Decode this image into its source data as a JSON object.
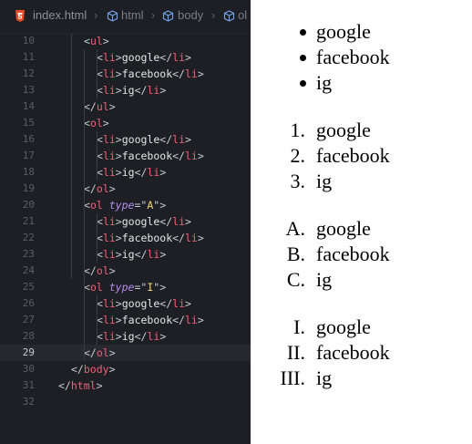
{
  "breadcrumb": {
    "file": "index.html",
    "items": [
      "html",
      "body",
      "ol"
    ]
  },
  "code_lines": [
    {
      "n": "10",
      "i": 2,
      "t": [
        [
          "t-br",
          "<"
        ],
        [
          "t-tag",
          "ul"
        ],
        [
          "t-br",
          ">"
        ]
      ]
    },
    {
      "n": "11",
      "i": 3,
      "t": [
        [
          "t-br",
          "<"
        ],
        [
          "t-tag",
          "li"
        ],
        [
          "t-br",
          ">"
        ],
        [
          "t-txt",
          "google"
        ],
        [
          "t-br",
          "</"
        ],
        [
          "t-tag",
          "li"
        ],
        [
          "t-br",
          ">"
        ]
      ]
    },
    {
      "n": "12",
      "i": 3,
      "t": [
        [
          "t-br",
          "<"
        ],
        [
          "t-tag",
          "li"
        ],
        [
          "t-br",
          ">"
        ],
        [
          "t-txt",
          "facebook"
        ],
        [
          "t-br",
          "</"
        ],
        [
          "t-tag",
          "li"
        ],
        [
          "t-br",
          ">"
        ]
      ]
    },
    {
      "n": "13",
      "i": 3,
      "t": [
        [
          "t-br",
          "<"
        ],
        [
          "t-tag",
          "li"
        ],
        [
          "t-br",
          ">"
        ],
        [
          "t-txt",
          "ig"
        ],
        [
          "t-br",
          "</"
        ],
        [
          "t-tag",
          "li"
        ],
        [
          "t-br",
          ">"
        ]
      ]
    },
    {
      "n": "14",
      "i": 2,
      "t": [
        [
          "t-br",
          "</"
        ],
        [
          "t-tag",
          "ul"
        ],
        [
          "t-br",
          ">"
        ]
      ]
    },
    {
      "n": "15",
      "i": 2,
      "t": [
        [
          "t-br",
          "<"
        ],
        [
          "t-tag",
          "ol"
        ],
        [
          "t-br",
          ">"
        ]
      ]
    },
    {
      "n": "16",
      "i": 3,
      "t": [
        [
          "t-br",
          "<"
        ],
        [
          "t-tag",
          "li"
        ],
        [
          "t-br",
          ">"
        ],
        [
          "t-txt",
          "google"
        ],
        [
          "t-br",
          "</"
        ],
        [
          "t-tag",
          "li"
        ],
        [
          "t-br",
          ">"
        ]
      ]
    },
    {
      "n": "17",
      "i": 3,
      "t": [
        [
          "t-br",
          "<"
        ],
        [
          "t-tag",
          "li"
        ],
        [
          "t-br",
          ">"
        ],
        [
          "t-txt",
          "facebook"
        ],
        [
          "t-br",
          "</"
        ],
        [
          "t-tag",
          "li"
        ],
        [
          "t-br",
          ">"
        ]
      ]
    },
    {
      "n": "18",
      "i": 3,
      "t": [
        [
          "t-br",
          "<"
        ],
        [
          "t-tag",
          "li"
        ],
        [
          "t-br",
          ">"
        ],
        [
          "t-txt",
          "ig"
        ],
        [
          "t-br",
          "</"
        ],
        [
          "t-tag",
          "li"
        ],
        [
          "t-br",
          ">"
        ]
      ]
    },
    {
      "n": "19",
      "i": 2,
      "t": [
        [
          "t-br",
          "</"
        ],
        [
          "t-tag",
          "ol"
        ],
        [
          "t-br",
          ">"
        ]
      ]
    },
    {
      "n": "20",
      "i": 2,
      "t": [
        [
          "t-br",
          "<"
        ],
        [
          "t-tag",
          "ol"
        ],
        [
          "t-txt",
          " "
        ],
        [
          "t-attr",
          "type"
        ],
        [
          "t-eq",
          "="
        ],
        [
          "t-q",
          "\""
        ],
        [
          "t-str",
          "A"
        ],
        [
          "t-q",
          "\""
        ],
        [
          "t-br",
          ">"
        ]
      ]
    },
    {
      "n": "21",
      "i": 3,
      "t": [
        [
          "t-br",
          "<"
        ],
        [
          "t-tag",
          "li"
        ],
        [
          "t-br",
          ">"
        ],
        [
          "t-txt",
          "google"
        ],
        [
          "t-br",
          "</"
        ],
        [
          "t-tag",
          "li"
        ],
        [
          "t-br",
          ">"
        ]
      ]
    },
    {
      "n": "22",
      "i": 3,
      "t": [
        [
          "t-br",
          "<"
        ],
        [
          "t-tag",
          "li"
        ],
        [
          "t-br",
          ">"
        ],
        [
          "t-txt",
          "facebook"
        ],
        [
          "t-br",
          "</"
        ],
        [
          "t-tag",
          "li"
        ],
        [
          "t-br",
          ">"
        ]
      ]
    },
    {
      "n": "23",
      "i": 3,
      "t": [
        [
          "t-br",
          "<"
        ],
        [
          "t-tag",
          "li"
        ],
        [
          "t-br",
          ">"
        ],
        [
          "t-txt",
          "ig"
        ],
        [
          "t-br",
          "</"
        ],
        [
          "t-tag",
          "li"
        ],
        [
          "t-br",
          ">"
        ]
      ]
    },
    {
      "n": "24",
      "i": 2,
      "t": [
        [
          "t-br",
          "</"
        ],
        [
          "t-tag",
          "ol"
        ],
        [
          "t-br",
          ">"
        ]
      ]
    },
    {
      "n": "25",
      "i": 2,
      "t": [
        [
          "t-br",
          "<"
        ],
        [
          "t-tag",
          "ol"
        ],
        [
          "t-txt",
          " "
        ],
        [
          "t-attr",
          "type"
        ],
        [
          "t-eq",
          "="
        ],
        [
          "t-q",
          "\""
        ],
        [
          "t-str",
          "I"
        ],
        [
          "t-q",
          "\""
        ],
        [
          "t-br",
          ">"
        ]
      ]
    },
    {
      "n": "26",
      "i": 3,
      "t": [
        [
          "t-br",
          "<"
        ],
        [
          "t-tag",
          "li"
        ],
        [
          "t-br",
          ">"
        ],
        [
          "t-txt",
          "google"
        ],
        [
          "t-br",
          "</"
        ],
        [
          "t-tag",
          "li"
        ],
        [
          "t-br",
          ">"
        ]
      ]
    },
    {
      "n": "27",
      "i": 3,
      "t": [
        [
          "t-br",
          "<"
        ],
        [
          "t-tag",
          "li"
        ],
        [
          "t-br",
          ">"
        ],
        [
          "t-txt",
          "facebook"
        ],
        [
          "t-br",
          "</"
        ],
        [
          "t-tag",
          "li"
        ],
        [
          "t-br",
          ">"
        ]
      ]
    },
    {
      "n": "28",
      "i": 3,
      "t": [
        [
          "t-br",
          "<"
        ],
        [
          "t-tag",
          "li"
        ],
        [
          "t-br",
          ">"
        ],
        [
          "t-txt",
          "ig"
        ],
        [
          "t-br",
          "</"
        ],
        [
          "t-tag",
          "li"
        ],
        [
          "t-br",
          ">"
        ]
      ]
    },
    {
      "n": "29",
      "i": 2,
      "t": [
        [
          "t-br",
          "</"
        ],
        [
          "t-tag",
          "ol"
        ],
        [
          "t-br",
          ">"
        ]
      ],
      "current": true
    },
    {
      "n": "30",
      "i": 1,
      "t": [
        [
          "t-br",
          "</"
        ],
        [
          "t-tag",
          "body"
        ],
        [
          "t-br",
          ">"
        ]
      ]
    },
    {
      "n": "31",
      "i": 0,
      "t": [
        [
          "t-br",
          "</"
        ],
        [
          "t-tag",
          "html"
        ],
        [
          "t-br",
          ">"
        ]
      ]
    },
    {
      "n": "32",
      "i": 0,
      "t": []
    }
  ],
  "preview_lists": [
    {
      "type": "bullet",
      "items": [
        {
          "marker": "",
          "text": "google"
        },
        {
          "marker": "",
          "text": "facebook"
        },
        {
          "marker": "",
          "text": "ig"
        }
      ]
    },
    {
      "type": "decimal",
      "items": [
        {
          "marker": "1.",
          "text": "google"
        },
        {
          "marker": "2.",
          "text": "facebook"
        },
        {
          "marker": "3.",
          "text": "ig"
        }
      ]
    },
    {
      "type": "upper-alpha",
      "items": [
        {
          "marker": "A.",
          "text": "google"
        },
        {
          "marker": "B.",
          "text": "facebook"
        },
        {
          "marker": "C.",
          "text": "ig"
        }
      ]
    },
    {
      "type": "upper-roman",
      "items": [
        {
          "marker": "I.",
          "text": "google"
        },
        {
          "marker": "II.",
          "text": "facebook"
        },
        {
          "marker": "III.",
          "text": "ig"
        }
      ]
    }
  ]
}
